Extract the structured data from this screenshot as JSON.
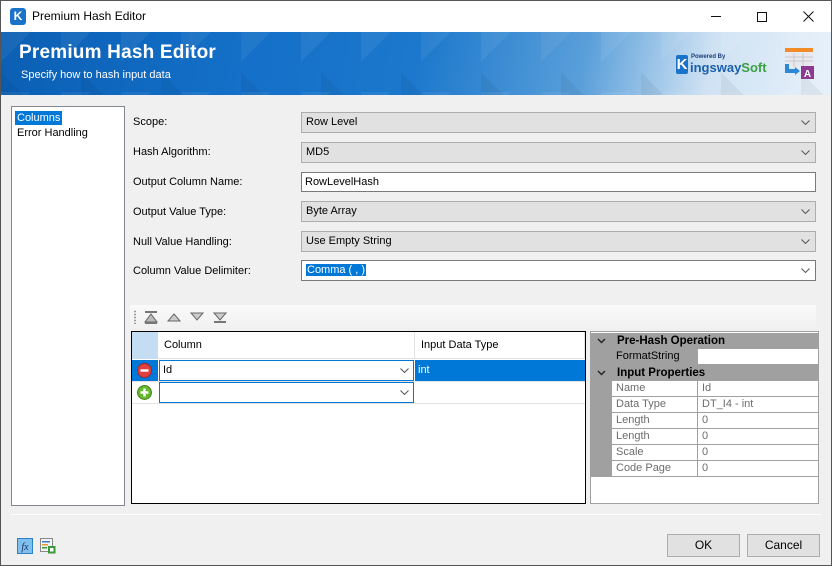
{
  "window": {
    "title": "Premium Hash Editor",
    "app_icon_letter": "K"
  },
  "banner": {
    "title": "Premium Hash Editor",
    "subtitle": "Specify how to hash input data",
    "logo": {
      "powered_by": "Powered By",
      "k": "K",
      "name_a": "ingsway",
      "name_b": "Soft"
    }
  },
  "nav": {
    "items": [
      {
        "label": "Columns",
        "selected": true
      },
      {
        "label": "Error Handling",
        "selected": false
      }
    ]
  },
  "form": {
    "scope": {
      "label": "Scope:",
      "value": "Row Level"
    },
    "hash_algorithm": {
      "label": "Hash Algorithm:",
      "value": "MD5"
    },
    "output_column_name": {
      "label": "Output Column Name:",
      "value": "RowLevelHash"
    },
    "output_value_type": {
      "label": "Output Value Type:",
      "value": "Byte Array"
    },
    "null_value_handling": {
      "label": "Null Value Handling:",
      "value": "Use Empty String"
    },
    "column_value_delimiter": {
      "label": "Column Value Delimiter:",
      "value": "Comma ( , )"
    }
  },
  "toolbar": {
    "buttons": [
      "move-to-top",
      "move-up",
      "move-down",
      "move-to-bottom"
    ]
  },
  "grid": {
    "headers": {
      "column": "Column",
      "input_type": "Input Data Type"
    },
    "rows": [
      {
        "column": "Id",
        "input_type": "int",
        "action": "remove"
      },
      {
        "column": "",
        "input_type": "",
        "action": "add"
      }
    ]
  },
  "properties": {
    "categories": [
      {
        "name": "Pre-Hash Operation",
        "rows": [
          {
            "name": "FormatString",
            "value": ""
          }
        ]
      },
      {
        "name": "Input Properties",
        "rows": [
          {
            "name": "Name",
            "value": "Id"
          },
          {
            "name": "Data Type",
            "value": "DT_I4 - int"
          },
          {
            "name": "Length",
            "value": "0"
          },
          {
            "name": "Length",
            "value": "0"
          },
          {
            "name": "Scale",
            "value": "0"
          },
          {
            "name": "Code Page",
            "value": "0"
          }
        ]
      }
    ]
  },
  "footer": {
    "ok_label": "OK",
    "cancel_label": "Cancel"
  },
  "colors": {
    "selection": "#0078d7",
    "banner_blue": "#1470c8",
    "property_gray": "#a0a0a0"
  }
}
